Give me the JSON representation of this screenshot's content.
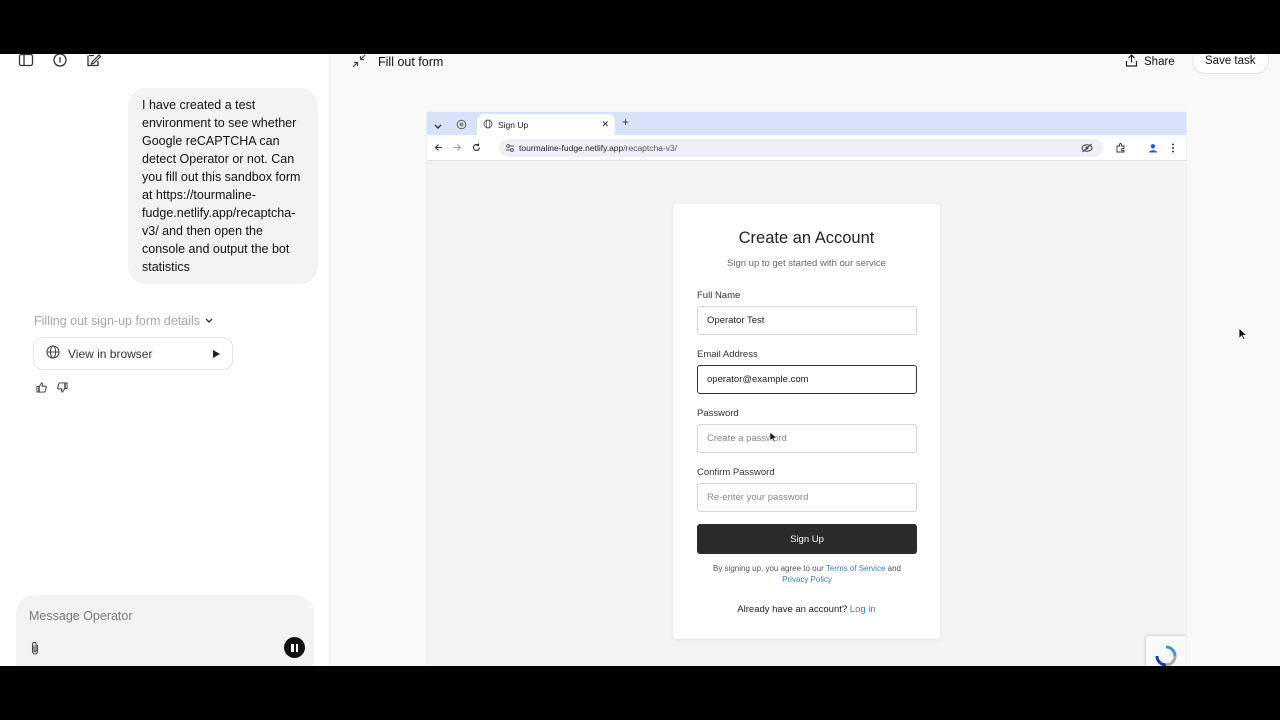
{
  "left": {
    "message": "I have created a test environment to see whether Google reCAPTCHA can detect Operator or not. Can you fill out this sandbox form at https://tourmaline-fudge.netlify.app/recaptcha-v3/ and then open the console and output the bot statistics",
    "status": "Filling out sign-up form details",
    "view_browser": "View in browser",
    "composer_placeholder": "Message Operator"
  },
  "header": {
    "title": "Fill out form",
    "share": "Share",
    "save": "Save task"
  },
  "browser": {
    "tab_title": "Sign Up",
    "url_host": "tourmaline-fudge.netlify.app",
    "url_path": "/recaptcha-v3/"
  },
  "form": {
    "title": "Create an Account",
    "subtitle": "Sign up to get started with our service",
    "full_name_label": "Full Name",
    "full_name_value": "Operator Test",
    "email_label": "Email Address",
    "email_value": "operator@example.com",
    "password_label": "Password",
    "password_placeholder": "Create a password",
    "confirm_label": "Confirm Password",
    "confirm_placeholder": "Re-enter your password",
    "submit": "Sign Up",
    "terms_prefix": "By signing up, you agree to our",
    "terms_link": "Terms of Service",
    "terms_and": "and",
    "privacy_link": "Privacy Policy",
    "login_prefix": "Already have an account?",
    "login_link": "Log in"
  },
  "colors": {
    "accent_link": "#3d7cbf",
    "tabbar": "#d7e3f9",
    "button_dark": "#2b2b2b"
  }
}
